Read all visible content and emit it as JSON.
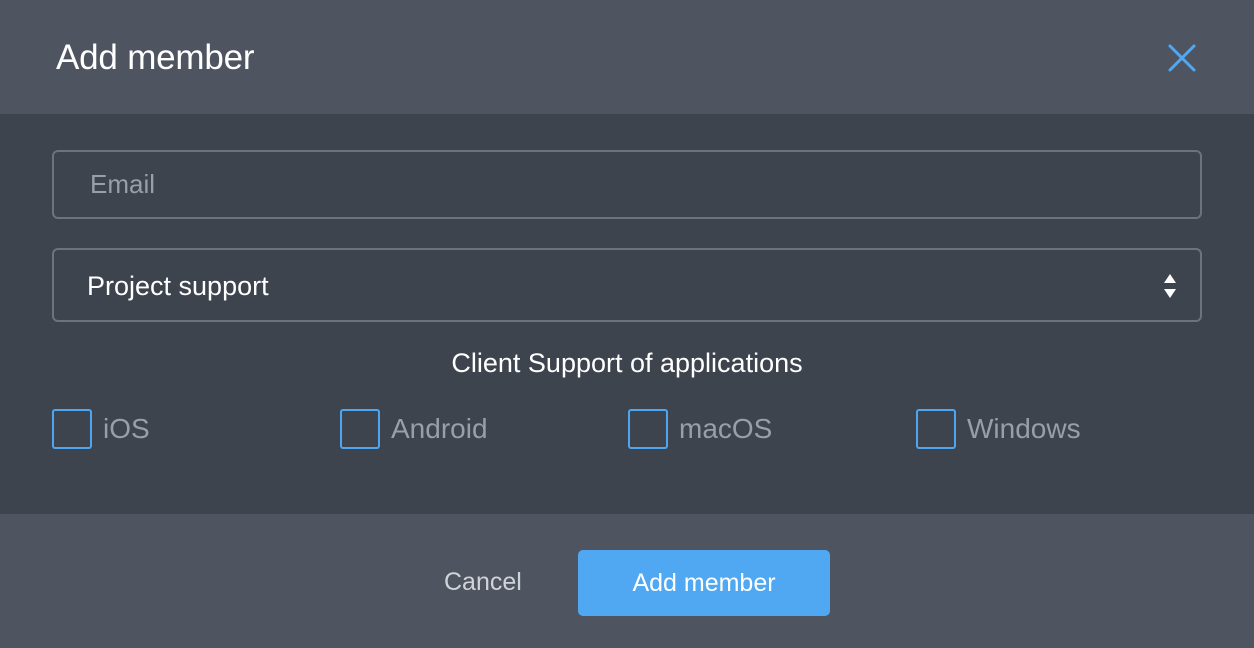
{
  "dialog": {
    "title": "Add member",
    "close_icon": "close-icon"
  },
  "form": {
    "email": {
      "value": "",
      "placeholder": "Email"
    },
    "role_select": {
      "selected": "Project support",
      "icon": "sort-arrows-icon"
    },
    "section_title": "Client Support of applications",
    "platforms": [
      {
        "label": "iOS",
        "checked": false
      },
      {
        "label": "Android",
        "checked": false
      },
      {
        "label": "macOS",
        "checked": false
      },
      {
        "label": "Windows",
        "checked": false
      }
    ]
  },
  "footer": {
    "cancel_label": "Cancel",
    "submit_label": "Add member"
  },
  "colors": {
    "header_bg": "#4f5560",
    "body_bg": "#3e444e",
    "accent": "#4fa8f1",
    "border": "#6d737d",
    "muted_text": "#9a9ea6"
  }
}
